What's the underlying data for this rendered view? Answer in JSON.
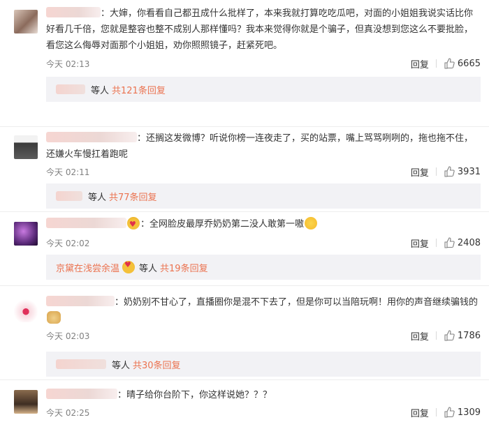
{
  "comments": [
    {
      "text": "：大婶，你看看自己都丑成什么批样了，本来我就打算吃吃瓜吧，对面的小姐姐我说实话比你好看几千倍，您就是整容也整不成别人那样懂吗？我本来觉得你就是个骗子，但真没想到您这么不要批脸，看您这么侮辱对面那个小姐姐，劝你照照镜子，赶紧死吧。",
      "time": "今天 02:13",
      "reply_label": "回复",
      "likes": "6665",
      "sub": {
        "suffix": "等人",
        "link": "共121条回复"
      }
    },
    {
      "text": "：还搁这发微博？听说你榜一连夜走了，买的站票，嘴上骂骂咧咧的，拖也拖不住，还嫌火车慢扛着跑呢",
      "time": "今天 02:11",
      "reply_label": "回复",
      "likes": "3931",
      "sub": {
        "suffix": "等人",
        "link": "共77条回复"
      }
    },
    {
      "text": "：全网脸皮最厚乔奶奶第二没人敢第一嗷",
      "time": "今天 02:02",
      "reply_label": "回复",
      "likes": "2408",
      "sub": {
        "name": "京黛在浅尝余温",
        "suffix": "等人",
        "link": "共19条回复"
      }
    },
    {
      "text": "：奶奶别不甘心了，直播圈你是混不下去了，但是你可以当陪玩啊！用你的声音继续骗钱的",
      "time": "今天 02:03",
      "reply_label": "回复",
      "likes": "1786",
      "sub": {
        "suffix": "等人",
        "link": "共30条回复"
      }
    },
    {
      "text": "：晴子给你台阶下，你这样说她？？？",
      "time": "今天 02:25",
      "reply_label": "回复",
      "likes": "1309"
    }
  ]
}
